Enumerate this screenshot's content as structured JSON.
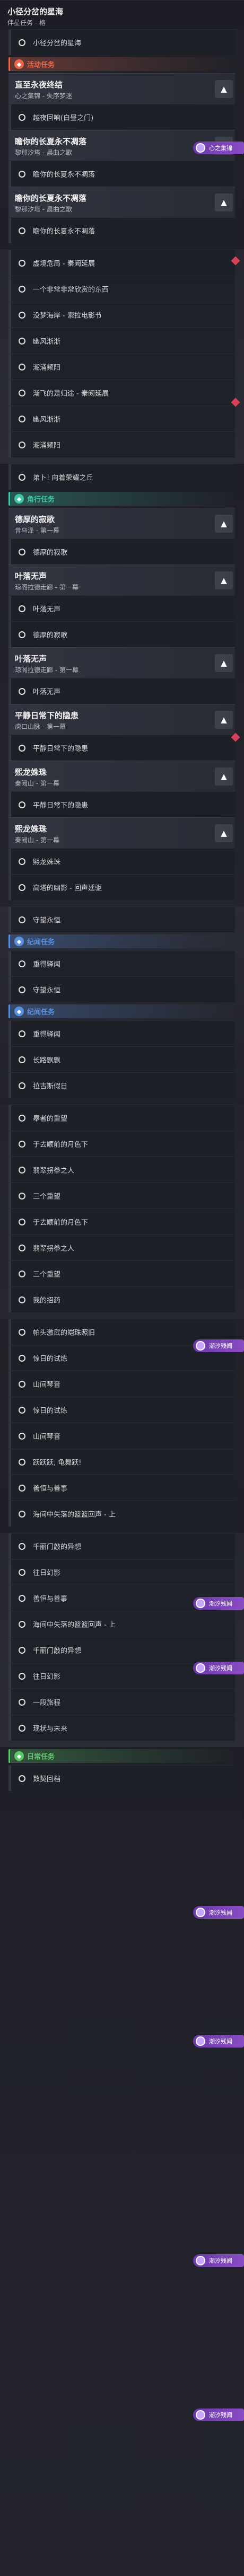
{
  "header": {
    "title": "小径分岔的星海",
    "subtitle": "伴星任务 - 格"
  },
  "blocks": [
    {
      "type": "item",
      "text": "小径分岔的星海"
    },
    {
      "type": "section",
      "label": "活动任务",
      "accent": "#e8684e"
    },
    {
      "type": "group",
      "title": "直至永夜终结",
      "subtitle": "心之集锦 - 失序梦迷"
    },
    {
      "type": "item",
      "text": "越夜回响(白昼之门)"
    },
    {
      "type": "group",
      "title": "瞻你的长夏永不凋落",
      "subtitle": "黎那汐塔 - 晨曲之歌"
    },
    {
      "type": "item",
      "text": "瞻你的长夏永不凋落"
    },
    {
      "type": "group",
      "title": "瞻你的长夏永不凋落",
      "subtitle": "黎那汐塔 - 晨曲之歌"
    },
    {
      "type": "item",
      "text": "瞻你的长夏永不凋落"
    },
    {
      "type": "item",
      "text": "虚境危局 - 秦阙延展"
    },
    {
      "type": "item",
      "text": "一个非常非常欣赏的东西"
    },
    {
      "type": "item",
      "text": "没梦海岸 - 索拉电影节"
    },
    {
      "type": "item",
      "text": "幽风淅淅"
    },
    {
      "type": "item",
      "text": "潮涌频阳"
    },
    {
      "type": "item",
      "text": "渐飞的是归途 - 秦阙延展"
    },
    {
      "type": "item",
      "text": "幽风淅淅"
    },
    {
      "type": "item",
      "text": "潮涌频阳"
    },
    {
      "type": "item",
      "text": "弟卜! 向着荣耀之丘"
    },
    {
      "type": "section",
      "label": "角行任务",
      "accent": "#40c6a8"
    },
    {
      "type": "group",
      "title": "德厚的寂歌",
      "subtitle": "昔乌泽 - 第一幕"
    },
    {
      "type": "item",
      "text": "德厚的寂歌"
    },
    {
      "type": "group",
      "title": "叶落无声",
      "subtitle": "琼阁拉德走廊 - 第一幕"
    },
    {
      "type": "item",
      "text": "叶落无声"
    },
    {
      "type": "item",
      "text": "德厚的寂歌"
    },
    {
      "type": "group",
      "title": "叶落无声",
      "subtitle": "琼阁拉德走廊 - 第一幕"
    },
    {
      "type": "item",
      "text": "叶落无声"
    },
    {
      "type": "group",
      "title": "平静日常下的隐患",
      "subtitle": "虎口山脉 - 第一幕"
    },
    {
      "type": "item",
      "text": "平静日常下的隐患"
    },
    {
      "type": "group",
      "title": "熙龙姝珠",
      "subtitle": "秦阙山 - 第一幕"
    },
    {
      "type": "item",
      "text": "平静日常下的隐患"
    },
    {
      "type": "group",
      "title": "熙龙姝珠",
      "subtitle": "秦阙山 - 第一幕"
    },
    {
      "type": "item",
      "text": "熙龙姝珠"
    },
    {
      "type": "item",
      "text": "高塔的幽影 - 回声廷驱"
    },
    {
      "type": "item",
      "text": "守望永恒"
    },
    {
      "type": "section",
      "label": "纪闻任务",
      "accent": "#5a8fe0"
    },
    {
      "type": "item",
      "text": "重得驿闻"
    },
    {
      "type": "item",
      "text": "守望永恒"
    },
    {
      "type": "section",
      "label": "纪闻任务",
      "accent": "#5a8fe0"
    },
    {
      "type": "item",
      "text": "重得驿闻"
    },
    {
      "type": "item",
      "text": "长路飘飘"
    },
    {
      "type": "item",
      "text": "拉古斯假日"
    },
    {
      "type": "item",
      "text": "皋者的重望"
    },
    {
      "type": "item",
      "text": "于去顺前的月色下"
    },
    {
      "type": "item",
      "text": "翡翠拐拳之人"
    },
    {
      "type": "item",
      "text": "三个重望"
    },
    {
      "type": "item",
      "text": "于去顺前的月色下"
    },
    {
      "type": "item",
      "text": "翡翠拐拳之人"
    },
    {
      "type": "item",
      "text": "三个重望"
    },
    {
      "type": "item",
      "text": "我的招药"
    },
    {
      "type": "item",
      "text": "帕头激武的皑珠照旧"
    },
    {
      "type": "item",
      "text": "惊日的试炼"
    },
    {
      "type": "item",
      "text": "山间琴音"
    },
    {
      "type": "item",
      "text": "惊日的试炼"
    },
    {
      "type": "item",
      "text": "山间琴音"
    },
    {
      "type": "item",
      "text": "跃跃跃, 龟舞跃!"
    },
    {
      "type": "item",
      "text": "善恒与善事"
    },
    {
      "type": "item",
      "text": "海间中失落的篮篮回声 - 上"
    },
    {
      "type": "item",
      "text": "千丽门敲的异想"
    },
    {
      "type": "item",
      "text": "往日幻影"
    },
    {
      "type": "item",
      "text": "善恒与善事"
    },
    {
      "type": "item",
      "text": "海间中失落的篮篮回声 - 上"
    },
    {
      "type": "item",
      "text": "千丽门敲的异想"
    },
    {
      "type": "item",
      "text": "往日幻影"
    },
    {
      "type": "item",
      "text": "一段旅程"
    },
    {
      "type": "item",
      "text": "现状与未来"
    },
    {
      "type": "section",
      "label": "日常任务",
      "accent": "#5cc86a"
    },
    {
      "type": "item",
      "text": "数契回档"
    }
  ],
  "tags": {
    "seal_label": "潮汐残闻",
    "marker_label": "心之集锦"
  },
  "colors": {
    "background": "#1b1c22",
    "seal": "#7a42b8",
    "diamond": "#d9405a"
  }
}
